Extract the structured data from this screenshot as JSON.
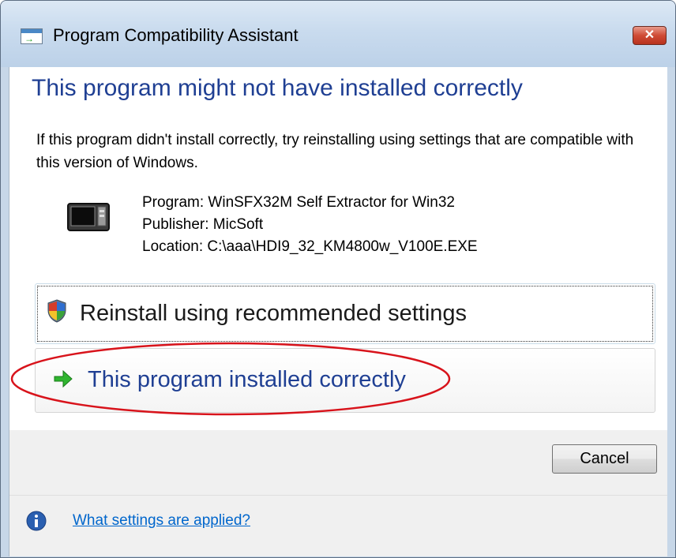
{
  "window": {
    "title": "Program Compatibility Assistant",
    "close_glyph": "✕",
    "title_icon": "compatibility-assistant-icon"
  },
  "main": {
    "heading": "This program might not have installed correctly",
    "description": "If this program didn't install correctly, try reinstalling using settings that are compatible with this version of Windows.",
    "program_icon": "program-box-icon",
    "program": "Program: WinSFX32M Self Extractor for Win32",
    "publisher": "Publisher: MicSoft",
    "location": "Location: C:\\aaa\\HDI9_32_KM4800w_V100E.EXE"
  },
  "options": [
    {
      "label": "Reinstall using recommended settings",
      "icon": "uac-shield-icon",
      "focused": true
    },
    {
      "label": "This program installed correctly",
      "icon": "green-arrow-icon",
      "circled": true
    }
  ],
  "footer": {
    "cancel_label": "Cancel",
    "help_link": "What settings are applied?",
    "help_icon": "info-icon"
  },
  "colors": {
    "heading": "#1f3f93",
    "link": "#0066cc",
    "annotation_oval": "#d8131b",
    "close_button": "#cf4b35"
  }
}
